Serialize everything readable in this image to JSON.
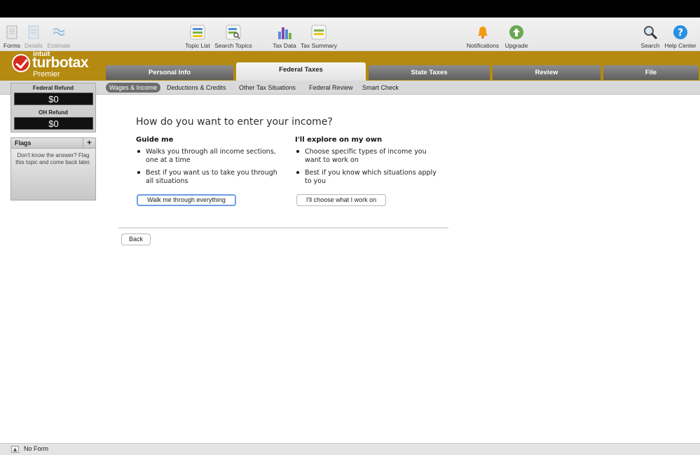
{
  "toolbar": {
    "forms": "Forms",
    "details": "Details",
    "estimate": "Estimate",
    "topic_list": "Topic List",
    "search_topics": "Search Topics",
    "tax_data": "Tax Data",
    "tax_summary": "Tax Summary",
    "notifications": "Notifications",
    "upgrade": "Upgrade",
    "search": "Search",
    "help_center": "Help Center"
  },
  "brand": {
    "intuit": "intuit",
    "name": "turbotax",
    "edition": "Premier"
  },
  "tabs": [
    {
      "label": "Personal Info",
      "active": false
    },
    {
      "label": "Federal Taxes",
      "active": true
    },
    {
      "label": "State Taxes",
      "active": false
    },
    {
      "label": "Review",
      "active": false
    },
    {
      "label": "File",
      "active": false
    }
  ],
  "subnav": [
    {
      "label": "Wages & Income",
      "active": true
    },
    {
      "label": "Deductions & Credits",
      "active": false
    },
    {
      "label": "Other Tax Situations",
      "active": false
    },
    {
      "label": "Federal Review",
      "active": false
    },
    {
      "label": "Smart Check",
      "active": false
    }
  ],
  "refunds": {
    "federal_label": "Federal Refund",
    "federal_amount": "$0",
    "state_label": "OH Refund",
    "state_amount": "$0"
  },
  "flags": {
    "title": "Flags",
    "plus": "+",
    "text": "Don't know the answer? Flag this topic and come back later."
  },
  "main": {
    "heading": "How do you want to enter your income?",
    "guide": {
      "title": "Guide me",
      "bullets": [
        "Walks you through all income sections, one at a time",
        "Best if you want us to take you through all situations"
      ],
      "button": "Walk me through everything"
    },
    "explore": {
      "title": "I'll explore on my own",
      "bullets": [
        "Choose specific types of income you want to work on",
        "Best if you know which situations apply to you"
      ],
      "button": "I'll choose what I work on"
    },
    "back": "Back"
  },
  "status": {
    "form": "No Form"
  },
  "colors": {
    "brand_gold": "#b58a10",
    "logo_red": "#d52b1e",
    "focus_blue": "#6b9ee4"
  }
}
